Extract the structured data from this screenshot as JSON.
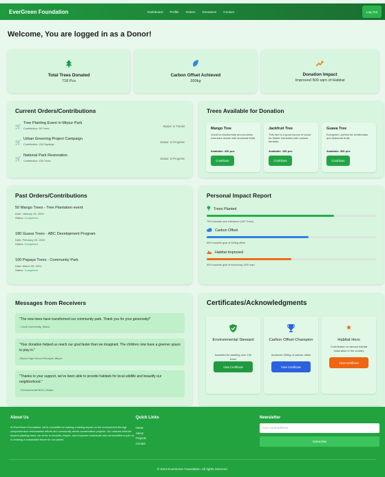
{
  "nav": {
    "brand": "EverGreen Foundation",
    "links": [
      "Dashboard",
      "Profile",
      "Orders",
      "Donations",
      "Contact"
    ],
    "logout": "Log Out"
  },
  "welcome": "Welcome, You are logged in as a Donor!",
  "stats": [
    {
      "icon": "tree-icon",
      "title": "Total Trees Donated",
      "value": "718 Pcs",
      "color": "#1f9a3f"
    },
    {
      "icon": "leaf-icon",
      "title": "Carbon Offset Achieved",
      "value": "300kg",
      "color": "#2f87e0"
    },
    {
      "icon": "trend-up-icon",
      "title": "Donation Impact",
      "value": "Improved 500 sqm of Habitat",
      "color": "#f07d1a"
    }
  ],
  "current": {
    "title": "Current Orders/Contributions",
    "items": [
      {
        "title": "Tree Planting Event in Mirpur Park",
        "sub": "Contribution: 50 Trees",
        "status": "Status: In Transit"
      },
      {
        "title": "Urban Greening Project Campaign",
        "sub": "Contribution: 200 Saplings",
        "status": "Status: In Progress"
      },
      {
        "title": "National Park Restoration",
        "sub": "Contribution: 150 Trees",
        "status": "Status: In Progress"
      }
    ]
  },
  "available": {
    "title": "Trees Available for Donation",
    "items": [
      {
        "name": "Mango Tree",
        "desc": "Great for biodiversity and provides extensive shade with seasonal fruits.",
        "avail": "Available: 200 pcs",
        "btn": "Contribute"
      },
      {
        "name": "Jackfruit Tree",
        "desc": "This tree is a good source of wood for timber industries with various benefits.",
        "avail": "Available: 150 pcs",
        "btn": "Contribute"
      },
      {
        "name": "Guava Tree",
        "desc": "Evergreen, perfect for windbreaks and seasonal fruits.",
        "avail": "Available: 300 pcs",
        "btn": "Contribute"
      }
    ]
  },
  "past": {
    "title": "Past Orders/Contributions",
    "items": [
      {
        "title": "50 Mango Trees - Tree Plantation event",
        "date": "Date: January 15, 2024",
        "status_label": "Status:",
        "status": "Completed"
      },
      {
        "title": "180 Guava Trees - ABC Development Program",
        "date": "Date: February 20, 2024",
        "status_label": "Status:",
        "status": "Completed"
      },
      {
        "title": "100 Papaya Trees - Community Park",
        "date": "Date: March 05, 2024",
        "status_label": "Status:",
        "status": "Completed"
      }
    ]
  },
  "impact": {
    "title": "Personal Impact Report",
    "items": [
      {
        "icon": "pin-icon",
        "label": "Trees Planted",
        "note": "75% towards next milestone (400 Trees)",
        "progress": 0.75,
        "color": "#22b04a"
      },
      {
        "icon": "cloud-icon",
        "label": "Carbon Offset",
        "note": "60% towards goal of 500kg offset",
        "progress": 0.6,
        "color": "#2f7fe3"
      },
      {
        "icon": "mountain-icon",
        "label": "Habitat Improved",
        "note": "50% towards goal of improving 1000 sqm",
        "progress": 0.5,
        "color": "#f06a1a"
      }
    ]
  },
  "messages": {
    "title": "Messages from Receivers",
    "items": [
      {
        "quote": "\"The new trees have transformed our community park. Thank you for your generosity!\"",
        "by": "- Local Community, Uttara"
      },
      {
        "quote": "\"Your donation helped us reach our goal faster than we imagined. The children now have a greener space to play in.\"",
        "by": "-Mirpur High School Principal, Mirpur"
      },
      {
        "quote": "\"Thanks to your support, we've been able to provide habitats for local wildlife and beautify our neighborhood.\"",
        "by": "- Environmental NGO, Dhaka"
      }
    ]
  },
  "certs": {
    "title": "Certificates/Acknowledgments",
    "items": [
      {
        "icon": "shield-check-icon",
        "name": "Environmental Steward",
        "desc": "Awarded for planting over 100 trees",
        "btn": "View Certificate",
        "color": "#1f9a3f"
      },
      {
        "icon": "trophy-icon",
        "name": "Carbon Offset Champion",
        "desc": "Achieved 500kg of carbon offset",
        "btn": "View Certificate",
        "color": "#2c62e0"
      },
      {
        "icon": "star-icon",
        "name": "Habitat Hero",
        "desc": "Contribution to various habitat restoration in the country",
        "btn": "View Certificate",
        "color": "#ef6512"
      }
    ]
  },
  "footer": {
    "about_title": "About Us",
    "about_text": "At EverGreen Foundation, we're committed to making a lasting impact on the environment through comprehensive reforestation efforts and community-driven conservation projects. Our mission extends beyond planting trees; we strive to educate, inspire, and empower individuals and communities to join us in creating a sustainable future for our planet.",
    "links_title": "Quick Links",
    "links": [
      "Home",
      "About",
      "Projects",
      "Contact"
    ],
    "news_title": "Newsletter",
    "email_placeholder": "Your email address",
    "subscribe": "Subscribe",
    "copyright": "© 2024 EverGreen Foundation. All rights reserved."
  }
}
